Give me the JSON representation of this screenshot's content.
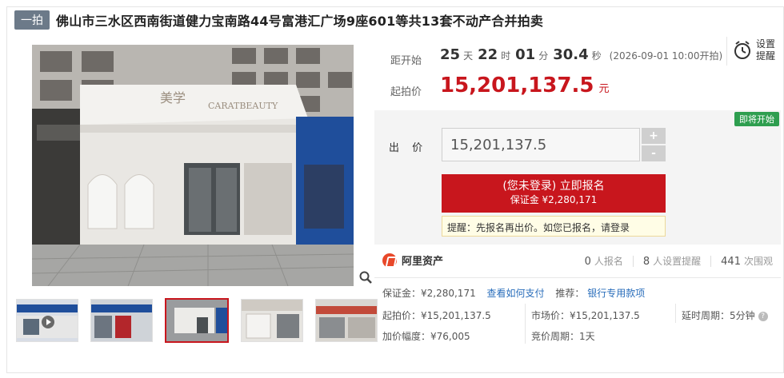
{
  "header": {
    "badge": "一拍",
    "title": "佛山市三水区西南街道健力宝南路44号富港汇广场9座601等共13套不动产合并拍卖"
  },
  "countdown": {
    "label": "距开始",
    "days": "25",
    "days_unit": "天",
    "hours": "22",
    "hours_unit": "时",
    "minutes": "01",
    "minutes_unit": "分",
    "seconds": "30.4",
    "seconds_unit": "秒",
    "start_note": "(2026-09-01 10:00开拍)"
  },
  "start_price": {
    "label": "起拍价",
    "value": "15,201,137.5",
    "unit": "元"
  },
  "remind": {
    "line1": "设置",
    "line2": "提醒",
    "icon": "alarm-clock-icon"
  },
  "bid": {
    "status_tag": "即将开始",
    "label": "出 价",
    "value": "15,201,137.5",
    "plus": "+",
    "minus": "-",
    "signup_main": "(您未登录) 立即报名",
    "signup_sub": "保证金 ¥2,280,171",
    "tip": "提醒：先报名再出价。如您已报名，请登录"
  },
  "seller": {
    "name": "阿里资产"
  },
  "stats": {
    "signups": "0",
    "signups_label": "人报名",
    "reminders": "8",
    "reminders_label": "人设置提醒",
    "views": "441",
    "views_label": "次围观"
  },
  "details": {
    "deposit": "保证金：¥2,280,171",
    "pay_link": "查看如何支付",
    "recommend": "推荐：",
    "bank_link": "银行专用款项",
    "start_price": "起拍价：¥15,201,137.5",
    "market_price": "市场价：¥15,201,137.5",
    "delay": "延时周期：5分钟",
    "increment": "加价幅度：¥76,005",
    "cycle": "竞价周期：1天"
  },
  "colors": {
    "accent_red": "#c8161d",
    "badge_gray": "#6c7a89",
    "status_green": "#2e9e4f",
    "link_blue": "#2a6ebb"
  }
}
